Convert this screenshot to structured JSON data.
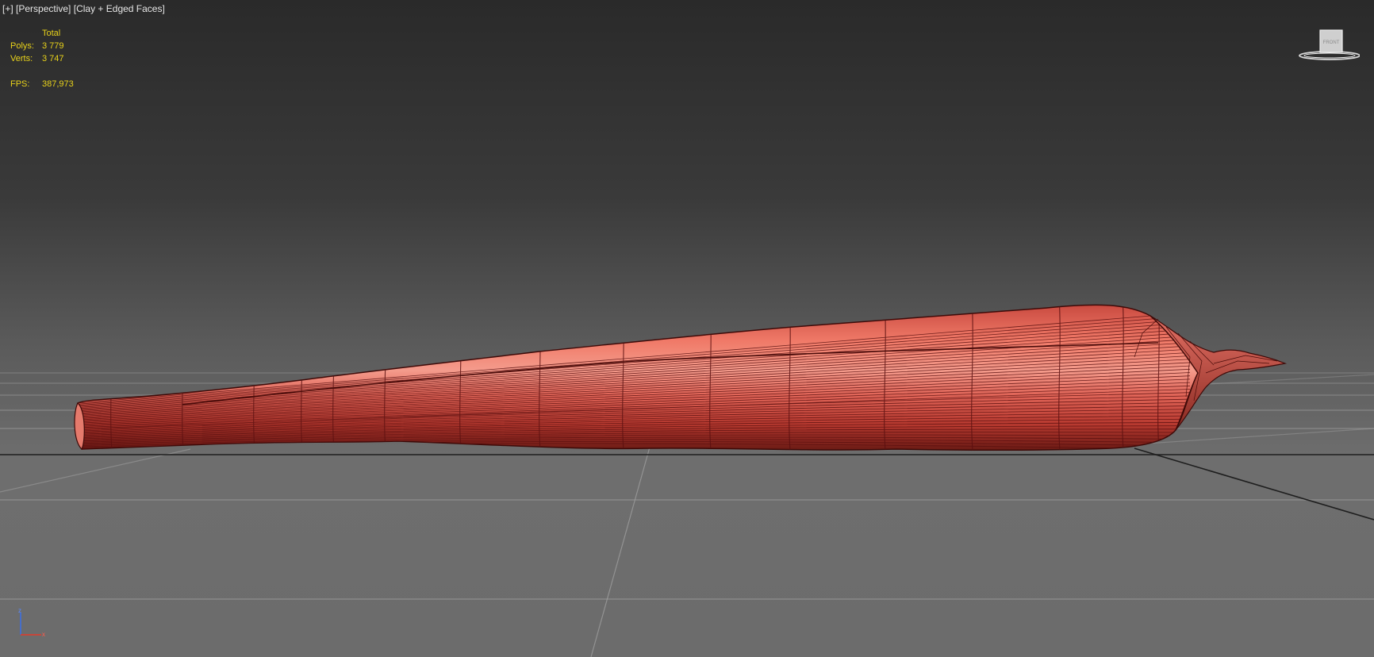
{
  "viewport": {
    "label_plus": "[+]",
    "label_view": "[Perspective]",
    "label_shading": "[Clay + Edged Faces]"
  },
  "stats": {
    "header": "Total",
    "polys_label": "Polys:",
    "polys_value": "3 779",
    "verts_label": "Verts:",
    "verts_value": "3 747",
    "fps_label": "FPS:",
    "fps_value": "387,973"
  },
  "viewcube": {
    "face_label": "FRONT"
  },
  "axis": {
    "z_label": "z",
    "x_label": "x"
  },
  "colors": {
    "stats_text": "#e8d21a",
    "label_text": "#e6e6e6",
    "mesh_fill": "#d8524a",
    "mesh_edges": "#5a1010",
    "grid": "#9a9a9a"
  }
}
